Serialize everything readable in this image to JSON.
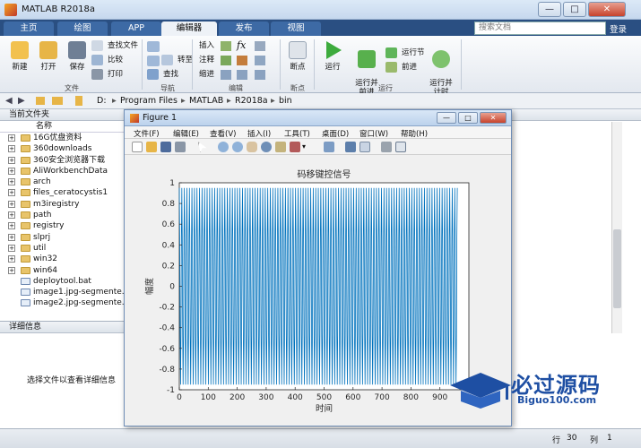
{
  "window": {
    "title": "MATLAB R2018a",
    "minimize": "—",
    "maximize": "□",
    "close": "✕"
  },
  "tabs": [
    {
      "label": "主页"
    },
    {
      "label": "绘图"
    },
    {
      "label": "APP"
    },
    {
      "label": "编辑器"
    },
    {
      "label": "发布"
    },
    {
      "label": "视图"
    }
  ],
  "search": {
    "placeholder": "搜索文档"
  },
  "login": "登录",
  "ribbon": {
    "file_group": {
      "new": "新建",
      "open": "打开",
      "save": "保存",
      "find_files": "查找文件",
      "compare": "比较",
      "print": "打印",
      "label": "文件"
    },
    "nav_group": {
      "goto": "转至",
      "find": "查找",
      "label": "导航"
    },
    "edit_group": {
      "insert": "插入",
      "comment": "注释",
      "indent": "缩进",
      "label": "编辑"
    },
    "breakpoint_group": {
      "breakpoints": "断点",
      "label": "断点"
    },
    "run_group": {
      "run": "运行",
      "run_advance": "运行并\n前进",
      "run_section": "运行节",
      "advance": "前进",
      "run_time": "运行并\n计时",
      "label": "运行"
    }
  },
  "address": {
    "back": "◀",
    "forward": "▶",
    "crumbs": [
      "D:",
      "Program Files",
      "MATLAB",
      "R2018a",
      "bin"
    ]
  },
  "folder_panel": {
    "title": "当前文件夹",
    "column": "名称",
    "items": [
      {
        "name": "16G优盘资料",
        "type": "folder"
      },
      {
        "name": "360downloads",
        "type": "folder"
      },
      {
        "name": "360安全浏览器下载",
        "type": "folder"
      },
      {
        "name": "AliWorkbenchData",
        "type": "folder"
      },
      {
        "name": "arch",
        "type": "folder"
      },
      {
        "name": "files_ceratocystis1",
        "type": "folder"
      },
      {
        "name": "m3iregistry",
        "type": "folder"
      },
      {
        "name": "path",
        "type": "folder"
      },
      {
        "name": "registry",
        "type": "folder"
      },
      {
        "name": "slprj",
        "type": "folder"
      },
      {
        "name": "util",
        "type": "folder"
      },
      {
        "name": "win32",
        "type": "folder"
      },
      {
        "name": "win64",
        "type": "folder"
      },
      {
        "name": "deploytool.bat",
        "type": "file"
      },
      {
        "name": "image1.jpg-segmente...",
        "type": "file"
      },
      {
        "name": "image2.jpg-segmente...",
        "type": "file"
      }
    ]
  },
  "details_panel": {
    "title": "详细信息",
    "hint": "选择文件以查看详细信息"
  },
  "figure": {
    "title": "Figure 1",
    "menu": [
      "文件(F)",
      "编辑(E)",
      "查看(V)",
      "插入(I)",
      "工具(T)",
      "桌面(D)",
      "窗口(W)",
      "帮助(H)"
    ]
  },
  "statusbar": {
    "row_label": "行",
    "row": "30",
    "col_label": "列",
    "col": "1"
  },
  "watermark": {
    "text": "必过源码",
    "url": "Biguo100.com"
  },
  "chart_data": {
    "type": "line",
    "title": "码移键控信号",
    "xlabel": "时间",
    "ylabel": "幅度",
    "xlim": [
      0,
      1000
    ],
    "ylim": [
      -1,
      1
    ],
    "xticks": [
      0,
      100,
      200,
      300,
      400,
      500,
      600,
      700,
      800,
      900
    ],
    "yticks": [
      -1,
      -0.8,
      -0.6,
      -0.4,
      -0.2,
      0,
      0.2,
      0.4,
      0.6,
      0.8,
      1
    ],
    "series": [
      {
        "color": "#0072bd",
        "waveform": "oscillating signal of amplitude about 0.95 filling the full axis, roughly 110 cycles over the span",
        "amplitude": 0.95,
        "cycles": 110,
        "x_start": 0,
        "x_end": 960
      }
    ],
    "grid": false
  }
}
